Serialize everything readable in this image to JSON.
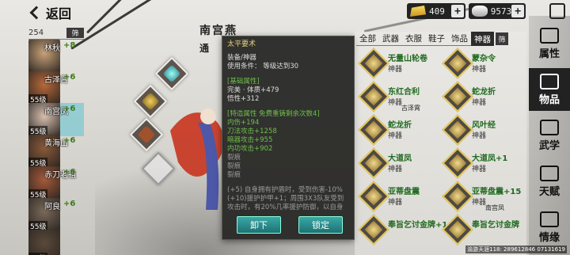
{
  "topbar": {
    "back_label": "返回",
    "gold_value": "409",
    "silver_value": "9573",
    "plus_label": "+"
  },
  "left": {
    "level_filter_value": "254",
    "filter_label": "筛",
    "heroes": [
      {
        "name": "林秋",
        "plus": "+8",
        "level": "",
        "color": "#c9a37a"
      },
      {
        "name": "古泽霄",
        "plus": "+6",
        "level": "55级",
        "color": "#b86a3a"
      },
      {
        "name": "南宫凤",
        "plus": "+6",
        "level": "55级",
        "color": "#d8c0b0"
      },
      {
        "name": "黄海山",
        "plus": "+6",
        "level": "55级",
        "color": "#8a5a3a"
      },
      {
        "name": "赤刀老祖",
        "plus": "+6",
        "level": "55级",
        "color": "#a55a3a"
      },
      {
        "name": "阿良",
        "plus": "+6",
        "level": "55级",
        "color": "#7a6a5a"
      },
      {
        "name": "",
        "plus": "",
        "level": "55级",
        "color": "#5a4a3a"
      }
    ]
  },
  "character": {
    "name": "南宫燕",
    "subtitle": "通"
  },
  "popup": {
    "title": "太平要术",
    "type_line": "装备/神器",
    "condition_line": "使用条件：   等级达到30",
    "base_header": "[基础属性]",
    "base_lines": [
      "完美 · 体质+479",
      "悟性+312"
    ],
    "special_header": "[特造属性  免费重铸剩余次数4]",
    "special_lines": [
      "内伤+194",
      "刀法攻击+1258",
      "暗器攻击+955",
      "内功攻击+902"
    ],
    "slot_lines": [
      "裂痕",
      "裂痕",
      "裂痕"
    ],
    "desc": "(+5) 自身拥有护盾时，受到伤害-10%(+10)援护护甲+1；周围3X3队友受到攻击时，有20%几率援护防御，以自身",
    "unequip_label": "卸下",
    "lock_label": "锁定"
  },
  "tabs": [
    {
      "label": "全部",
      "active": false
    },
    {
      "label": "武器",
      "active": false
    },
    {
      "label": "衣服",
      "active": false
    },
    {
      "label": "鞋子",
      "active": false
    },
    {
      "label": "饰品",
      "active": false
    },
    {
      "label": "神器",
      "active": true
    }
  ],
  "tab_filter_label": "筛",
  "items": [
    {
      "name": "无量山轮卷",
      "type": "神器",
      "equipped": ""
    },
    {
      "name": "蒙杂令",
      "type": "神器",
      "equipped": ""
    },
    {
      "name": "东红合利",
      "type": "神器",
      "equipped": "古泽霄"
    },
    {
      "name": "蛇龙折",
      "type": "神器",
      "equipped": ""
    },
    {
      "name": "蛇龙折",
      "type": "神器",
      "equipped": ""
    },
    {
      "name": "风叶经",
      "type": "神器",
      "equipped": ""
    },
    {
      "name": "大道凤",
      "type": "神器",
      "equipped": ""
    },
    {
      "name": "大道凤+1",
      "type": "神器",
      "equipped": ""
    },
    {
      "name": "亚蒂盘震",
      "type": "神器",
      "equipped": ""
    },
    {
      "name": "亚蒂盘震+15",
      "type": "神器",
      "equipped": "南宫凤"
    },
    {
      "name": "奉旨乞讨金牌+1",
      "type": "",
      "equipped": ""
    },
    {
      "name": "奉旨乞讨金牌",
      "type": "",
      "equipped": ""
    }
  ],
  "nav": [
    {
      "label": "属性",
      "active": false
    },
    {
      "label": "物品",
      "active": true
    },
    {
      "label": "武学",
      "active": false
    },
    {
      "label": "天赋",
      "active": false
    },
    {
      "label": "情缘",
      "active": false
    }
  ],
  "footer_text": "渝游天涯118: 289612846  07131619"
}
